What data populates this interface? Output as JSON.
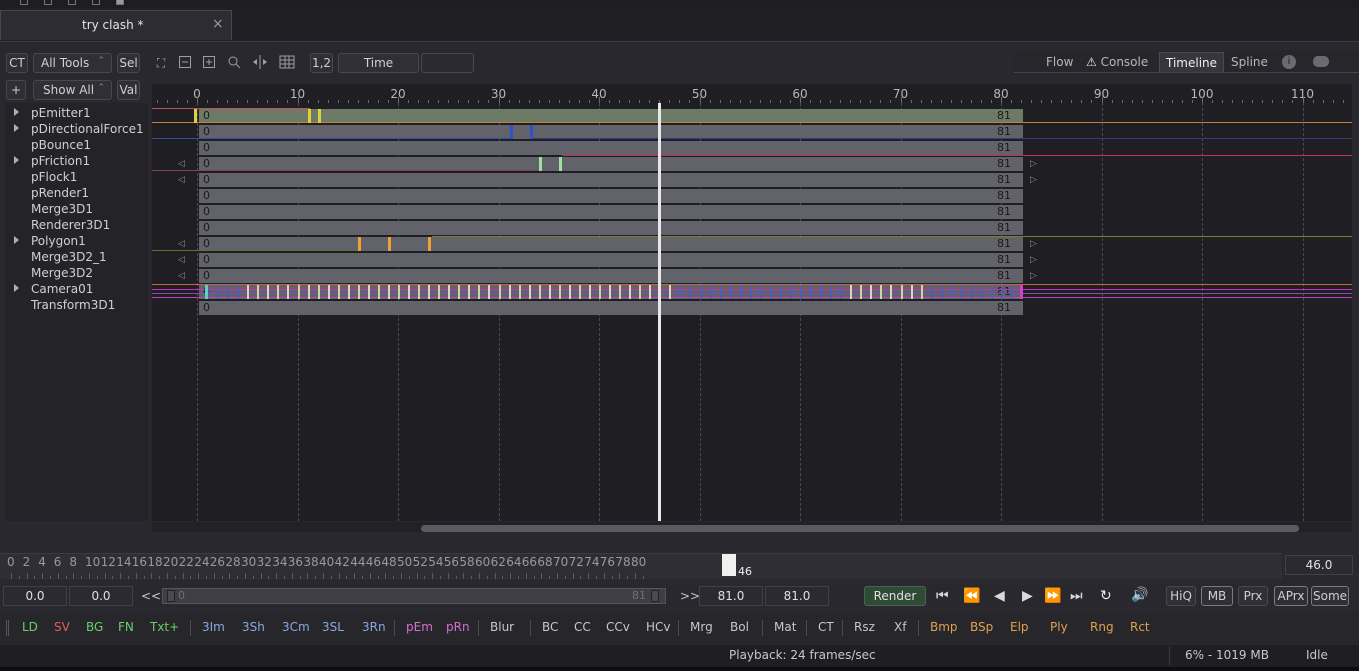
{
  "document_tab": {
    "title": "try clash *",
    "close": "×"
  },
  "toolbar": {
    "ct": "CT",
    "all_tools": "All Tools",
    "sel": "Sel",
    "plus": "+",
    "show_all": "Show All",
    "val": "Val",
    "frame_label": "1,2",
    "time_label": "Time"
  },
  "view_tabs": {
    "flow": "Flow",
    "console": "Console",
    "timeline": "Timeline",
    "spline": "Spline"
  },
  "tree": {
    "items": [
      {
        "label": "pEmitter1",
        "expandable": true
      },
      {
        "label": "pDirectionalForce1",
        "expandable": true
      },
      {
        "label": "pBounce1",
        "expandable": false
      },
      {
        "label": "pFriction1",
        "expandable": true
      },
      {
        "label": "pFlock1",
        "expandable": false
      },
      {
        "label": "pRender1",
        "expandable": false
      },
      {
        "label": "Merge3D1",
        "expandable": false
      },
      {
        "label": "Renderer3D1",
        "expandable": false
      },
      {
        "label": "Polygon1",
        "expandable": true
      },
      {
        "label": "Merge3D2_1",
        "expandable": false
      },
      {
        "label": "Merge3D2",
        "expandable": false
      },
      {
        "label": "Camera01",
        "expandable": true
      },
      {
        "label": "Transform3D1",
        "expandable": false
      }
    ]
  },
  "timeline": {
    "ruler": [
      "0",
      "10",
      "20",
      "30",
      "40",
      "50",
      "60",
      "70",
      "80",
      "90",
      "100",
      "110"
    ],
    "bar_start": "0",
    "bar_end": "81",
    "playhead_frame": 46
  },
  "time_ruler": {
    "labels": [
      "0",
      "2",
      "4",
      "6",
      "8",
      "10",
      "12",
      "14",
      "16",
      "18",
      "20",
      "22",
      "24",
      "26",
      "28",
      "30",
      "32",
      "34",
      "36",
      "38",
      "40",
      "42",
      "44",
      "46",
      "48",
      "50",
      "52",
      "54",
      "56",
      "58",
      "60",
      "62",
      "64",
      "66",
      "68",
      "70",
      "72",
      "74",
      "76",
      "78",
      "80"
    ],
    "current": "46",
    "current_value": "46.0"
  },
  "transport": {
    "global_start": "0.0",
    "render_start": "0.0",
    "prev_marker": "<<",
    "range_start": "0",
    "range_end": "81",
    "next_marker": ">>",
    "render_end": "81.0",
    "global_end": "81.0",
    "render": "Render",
    "hiq": "HiQ",
    "mb": "MB",
    "prx": "Prx",
    "aprx": "APrx",
    "some": "Some"
  },
  "tools": [
    {
      "label": "LD",
      "color": "#6ad06a"
    },
    {
      "label": "SV",
      "color": "#e06060"
    },
    {
      "label": "BG",
      "color": "#6ad06a"
    },
    {
      "label": "FN",
      "color": "#6ad06a"
    },
    {
      "label": "Txt+",
      "color": "#6ad06a"
    },
    {
      "label": "3Im",
      "color": "#8aa8e0"
    },
    {
      "label": "3Sh",
      "color": "#8aa8e0"
    },
    {
      "label": "3Cm",
      "color": "#8aa8e0"
    },
    {
      "label": "3SL",
      "color": "#8aa8e0"
    },
    {
      "label": "3Rn",
      "color": "#8aa8e0"
    },
    {
      "label": "pEm",
      "color": "#d070d0"
    },
    {
      "label": "pRn",
      "color": "#d070d0"
    },
    {
      "label": "Blur",
      "color": "#c8c8c8"
    },
    {
      "label": "BC",
      "color": "#c8c8c8"
    },
    {
      "label": "CC",
      "color": "#c8c8c8"
    },
    {
      "label": "CCv",
      "color": "#c8c8c8"
    },
    {
      "label": "HCv",
      "color": "#c8c8c8"
    },
    {
      "label": "Mrg",
      "color": "#c8c8c8"
    },
    {
      "label": "Bol",
      "color": "#c8c8c8"
    },
    {
      "label": "Mat",
      "color": "#c8c8c8"
    },
    {
      "label": "CT",
      "color": "#c8c8c8"
    },
    {
      "label": "Rsz",
      "color": "#c8c8c8"
    },
    {
      "label": "Xf",
      "color": "#c8c8c8"
    },
    {
      "label": "Bmp",
      "color": "#e0a050"
    },
    {
      "label": "BSp",
      "color": "#e0a050"
    },
    {
      "label": "Elp",
      "color": "#e0a050"
    },
    {
      "label": "Ply",
      "color": "#e0a050"
    },
    {
      "label": "Rng",
      "color": "#e0a050"
    },
    {
      "label": "Rct",
      "color": "#e0a050"
    }
  ],
  "status": {
    "playback": "Playback: 24 frames/sec",
    "memory": "6% - 1019 MB",
    "state": "Idle"
  }
}
